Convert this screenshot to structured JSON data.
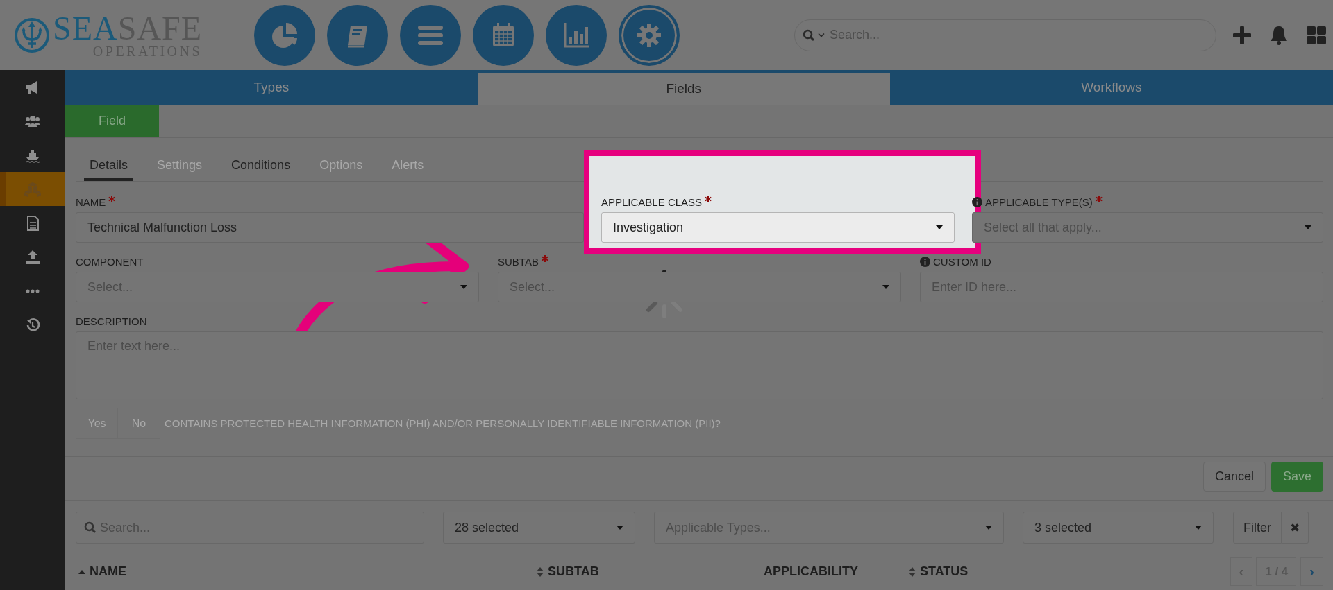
{
  "brand": {
    "name_part1": "SEA",
    "name_part2": "SAFE",
    "subtitle": "OPERATIONS"
  },
  "nav_buttons": [
    {
      "kind": "pie",
      "selected": false
    },
    {
      "kind": "book",
      "selected": false
    },
    {
      "kind": "list",
      "selected": false
    },
    {
      "kind": "calendar",
      "selected": false
    },
    {
      "kind": "bars",
      "selected": false
    },
    {
      "kind": "gear",
      "selected": true
    }
  ],
  "search": {
    "placeholder": "Search..."
  },
  "sidebar": {
    "items": [
      {
        "kind": "megaphone",
        "selected": false
      },
      {
        "kind": "users",
        "selected": false
      },
      {
        "kind": "ship",
        "selected": false
      },
      {
        "kind": "boxes",
        "selected": true
      },
      {
        "kind": "document",
        "selected": false
      },
      {
        "kind": "upload",
        "selected": false
      },
      {
        "kind": "dots",
        "selected": false
      },
      {
        "kind": "history",
        "selected": false
      }
    ]
  },
  "main_tabs": [
    {
      "label": "Types",
      "selected": false
    },
    {
      "label": "Fields",
      "selected": true
    },
    {
      "label": "Workflows",
      "selected": false
    }
  ],
  "section_button": "Field",
  "subtabs": [
    {
      "label": "Details",
      "selected": true,
      "disabled": false
    },
    {
      "label": "Settings",
      "selected": false,
      "disabled": true
    },
    {
      "label": "Conditions",
      "selected": false,
      "disabled": false
    },
    {
      "label": "Options",
      "selected": false,
      "disabled": true
    },
    {
      "label": "Alerts",
      "selected": false,
      "disabled": true
    }
  ],
  "form": {
    "fields": [
      {
        "kind": "text",
        "label": "NAME",
        "required": true,
        "info": false,
        "highlighted": false,
        "value": "Technical Malfunction Loss"
      },
      {
        "kind": "select",
        "label": "APPLICABLE CLASS",
        "required": true,
        "info": false,
        "highlighted": true,
        "value": "Investigation"
      },
      {
        "kind": "select",
        "label": "APPLICABLE TYPE(S)",
        "required": true,
        "info": true,
        "highlighted": false,
        "placeholder": "Select all that apply..."
      },
      {
        "kind": "select",
        "label": "COMPONENT",
        "required": false,
        "info": false,
        "highlighted": false,
        "placeholder": "Select..."
      },
      {
        "kind": "select",
        "label": "SUBTAB",
        "required": true,
        "info": false,
        "highlighted": false,
        "placeholder": "Select..."
      },
      {
        "kind": "text",
        "label": "CUSTOM ID",
        "required": false,
        "info": true,
        "highlighted": false,
        "placeholder": "Enter ID here..."
      },
      {
        "kind": "textarea",
        "label": "DESCRIPTION",
        "required": false,
        "info": false,
        "highlighted": false,
        "placeholder": "Enter text here..."
      }
    ],
    "phi": {
      "options": [
        "Yes",
        "No"
      ],
      "question": "CONTAINS PROTECTED HEALTH INFORMATION (PHI) AND/OR PERSONALLY IDENTIFIABLE INFORMATION (PII)?",
      "disabled": true
    }
  },
  "loading": true,
  "actions": [
    {
      "kind": "cancel",
      "label": "Cancel"
    },
    {
      "kind": "save",
      "label": "Save"
    }
  ],
  "filters": {
    "search_placeholder": "Search...",
    "selects": [
      {
        "value": "28 selected"
      },
      {
        "placeholder": "Applicable Types..."
      },
      {
        "value": "3 selected"
      }
    ],
    "filter_button": "Filter",
    "clear_button": "✖"
  },
  "table": {
    "columns": [
      {
        "label": "NAME",
        "kind": "sorted"
      },
      {
        "label": "SUBTAB",
        "kind": "sortable"
      },
      {
        "label": "APPLICABILITY",
        "kind": "plain"
      },
      {
        "label": "STATUS",
        "kind": "sortable"
      }
    ],
    "pagination": {
      "prev": "‹",
      "page": "1 / 4",
      "next": "›"
    }
  }
}
